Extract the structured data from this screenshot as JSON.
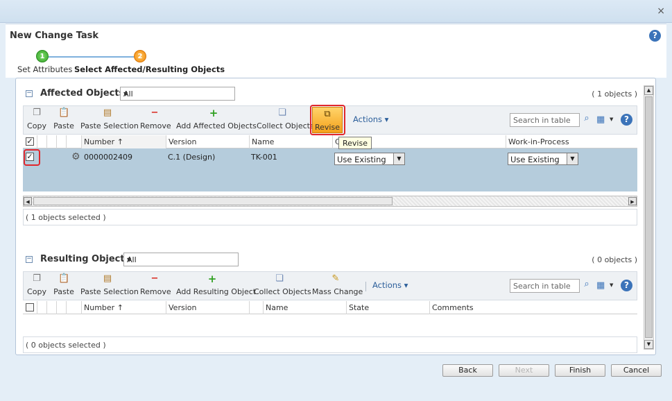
{
  "window": {
    "close_glyph": "×"
  },
  "header": {
    "title": "New Change Task",
    "help_glyph": "?"
  },
  "steps": [
    {
      "number": "1",
      "label": "Set Attributes",
      "state": "complete",
      "color": "#33a327"
    },
    {
      "number": "2",
      "label": "Select Affected/Resulting Objects",
      "state": "current",
      "color": "#f18a0f"
    }
  ],
  "affected": {
    "title": "Affected Objects",
    "filter_value": "All",
    "count": "( 1 objects )",
    "toolbar": {
      "copy": "Copy",
      "paste": "Paste",
      "paste_selection": "Paste Selection",
      "remove": "Remove",
      "add": "Add Affected Objects",
      "collect": "Collect Objects",
      "revise": "Revise",
      "actions": "Actions",
      "search_placeholder": "Search in table"
    },
    "columns": {
      "number": "Number",
      "sort_glyph": "↑",
      "version": "Version",
      "name": "Name",
      "disposition": "C",
      "wip": "Work-in-Process"
    },
    "rows": [
      {
        "checked": true,
        "number": "0000002409",
        "version": "C.1 (Design)",
        "name": "TK-001",
        "disposition": "Use Existing",
        "wip": "Use Existing"
      }
    ],
    "selected_status": "( 1 objects selected )",
    "tooltip": "Revise"
  },
  "resulting": {
    "title": "Resulting Objects",
    "filter_value": "All",
    "count": "( 0 objects )",
    "toolbar": {
      "copy": "Copy",
      "paste": "Paste",
      "paste_selection": "Paste Selection",
      "remove": "Remove",
      "add": "Add Resulting Object",
      "collect": "Collect Objects",
      "mass_change": "Mass Change",
      "actions": "Actions",
      "search_placeholder": "Search in table"
    },
    "columns": {
      "number": "Number",
      "sort_glyph": "↑",
      "version": "Version",
      "name": "Name",
      "state": "State",
      "comments": "Comments"
    },
    "selected_status": "( 0 objects selected )"
  },
  "buttons": {
    "back": "Back",
    "next": "Next",
    "finish": "Finish",
    "cancel": "Cancel"
  },
  "colors": {
    "accent": "#3b73b9",
    "highlight": "#e0262c",
    "revise": "#f5a11b",
    "selected_row": "#b5ccdc"
  }
}
